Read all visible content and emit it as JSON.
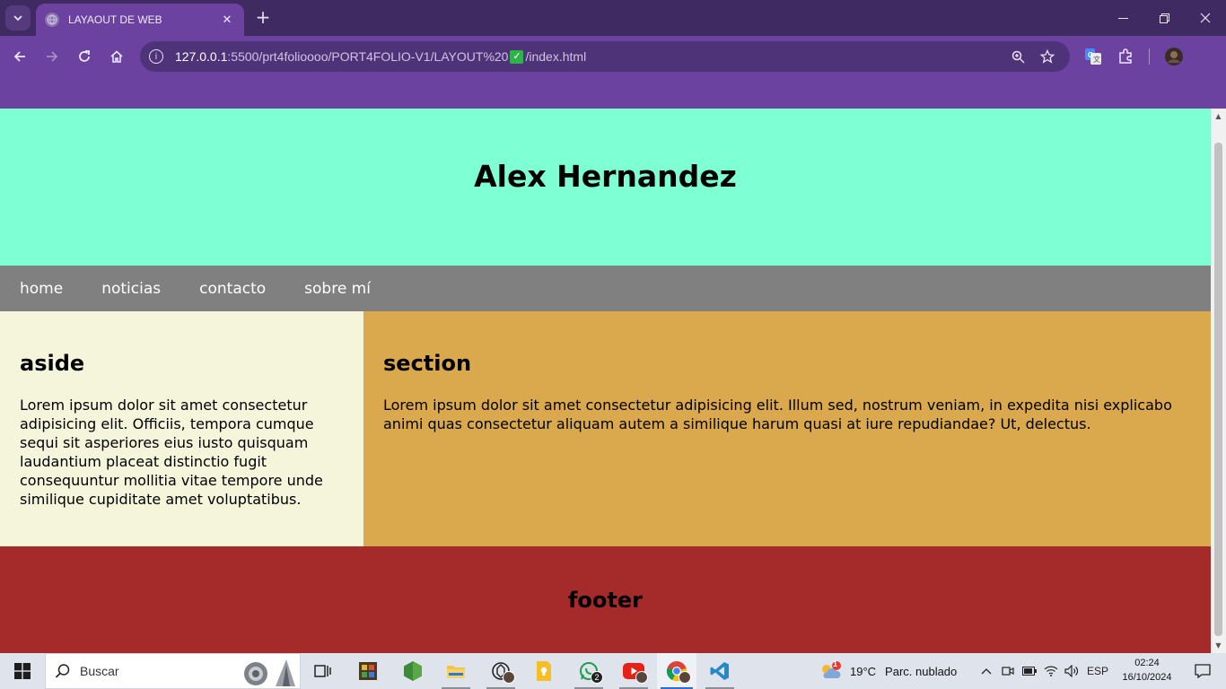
{
  "browser": {
    "tab_title": "LAYAOUT DE WEB",
    "url_host": "127.0.0.1",
    "url_rest_before": ":5500/prt4folioooo/PORT4FOLIO-V1/LAYOUT%20",
    "url_rest_after": "/index.html",
    "accent_color": "#6b42a0"
  },
  "page": {
    "header_title": "Alex Hernandez",
    "nav": [
      "home",
      "noticias",
      "contacto",
      "sobre mí"
    ],
    "aside": {
      "heading": "aside",
      "text": "Lorem ipsum dolor sit amet consectetur adipisicing elit. Officiis, tempora cumque sequi sit asperiores eius iusto quisquam laudantium placeat distinctio fugit consequuntur mollitia vitae tempore unde similique cupiditate amet voluptatibus."
    },
    "section": {
      "heading": "section",
      "text": "Lorem ipsum dolor sit amet consectetur adipisicing elit. Illum sed, nostrum veniam, in expedita nisi explicabo animi quas consectetur aliquam autem a similique harum quasi at iure repudiandae? Ut, delectus."
    },
    "footer_heading": "footer",
    "colors": {
      "header": "#7fffd4",
      "nav": "#808080",
      "aside": "#f5f5dc",
      "section": "#daa84d",
      "footer": "#a52a2a"
    }
  },
  "taskbar": {
    "search_placeholder": "Buscar",
    "weather_temp": "19°C",
    "weather_desc": "Parc. nublado",
    "weather_alert": "1",
    "language": "ESP",
    "time": "02:24",
    "date": "16/10/2024",
    "whatsapp_badge": "2"
  }
}
